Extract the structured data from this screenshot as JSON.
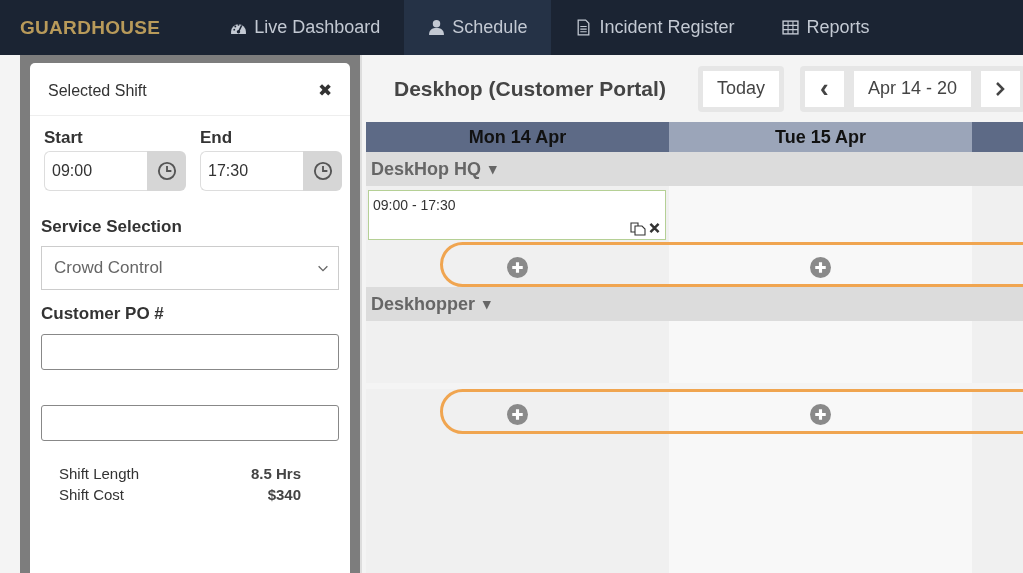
{
  "nav": {
    "brand": "GUARDHOUSE",
    "items": [
      {
        "label": "Live Dashboard",
        "selected": false
      },
      {
        "label": "Schedule",
        "selected": true
      },
      {
        "label": "Incident Register",
        "selected": false
      },
      {
        "label": "Reports",
        "selected": false
      }
    ]
  },
  "panel": {
    "title": "Selected Shift",
    "close": "✖",
    "start": {
      "label": "Start",
      "value": "09:00"
    },
    "end": {
      "label": "End",
      "value": "17:30"
    },
    "service": {
      "label": "Service Selection",
      "value": "Crowd Control"
    },
    "po": {
      "label": "Customer PO #"
    },
    "summary": [
      {
        "label": "Shift Length",
        "value": "8.5 Hrs"
      },
      {
        "label": "Shift Cost",
        "value": "$340"
      }
    ]
  },
  "schedule": {
    "title": "Deskhop (Customer Portal)",
    "today": "Today",
    "prev": "‹",
    "range": "Apr 14 - 20",
    "days": [
      {
        "label": "Mon 14 Apr",
        "selected": true
      },
      {
        "label": "Tue 15 Apr",
        "selected": false
      },
      {
        "selected": true
      }
    ],
    "groups": [
      {
        "name": "DeskHop HQ",
        "caret": "▾",
        "shifts": [
          {
            "time": "09:00 - 17:30"
          }
        ]
      },
      {
        "name": "Deskhopper",
        "caret": "▾"
      }
    ]
  }
}
